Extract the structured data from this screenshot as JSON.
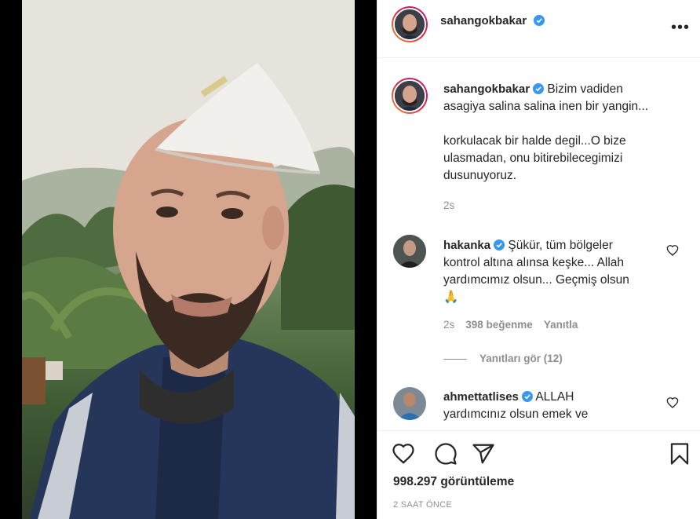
{
  "post": {
    "author": "sahangokbakar",
    "verified_icon": "verified-badge-icon",
    "more_icon": "more-options-icon"
  },
  "caption": {
    "author": "sahangokbakar",
    "line1": "Bizim vadiden",
    "line2": "asagiya salina salina inen bir yangin...",
    "line3": "korkulacak bir halde degil...O bize",
    "line4": "ulasmadan, onu bitirebilecegimizi",
    "line5": "dusunuyoruz.",
    "time": "2s"
  },
  "comments": [
    {
      "author": "hakanka",
      "line1": "Şükür, tüm bölgeler",
      "line2": "kontrol altına alınsa keşke... Allah",
      "line3": "yardımcımız olsun... Geçmiş olsun",
      "emoji": "🙏",
      "time": "2s",
      "likes": "398 beğenme",
      "reply": "Yanıtla",
      "view_replies": "Yanıtları gör (12)"
    },
    {
      "author": "ahmettatlises",
      "line1": "ALLAH",
      "line2": "yardımcınız olsun emek ve"
    }
  ],
  "footer": {
    "views": "998.297 görüntüleme",
    "timestamp": "2 SAAT ÖNCE"
  },
  "colors": {
    "verified": "#3897f0",
    "text": "#262626",
    "muted": "#8e8e8e"
  }
}
